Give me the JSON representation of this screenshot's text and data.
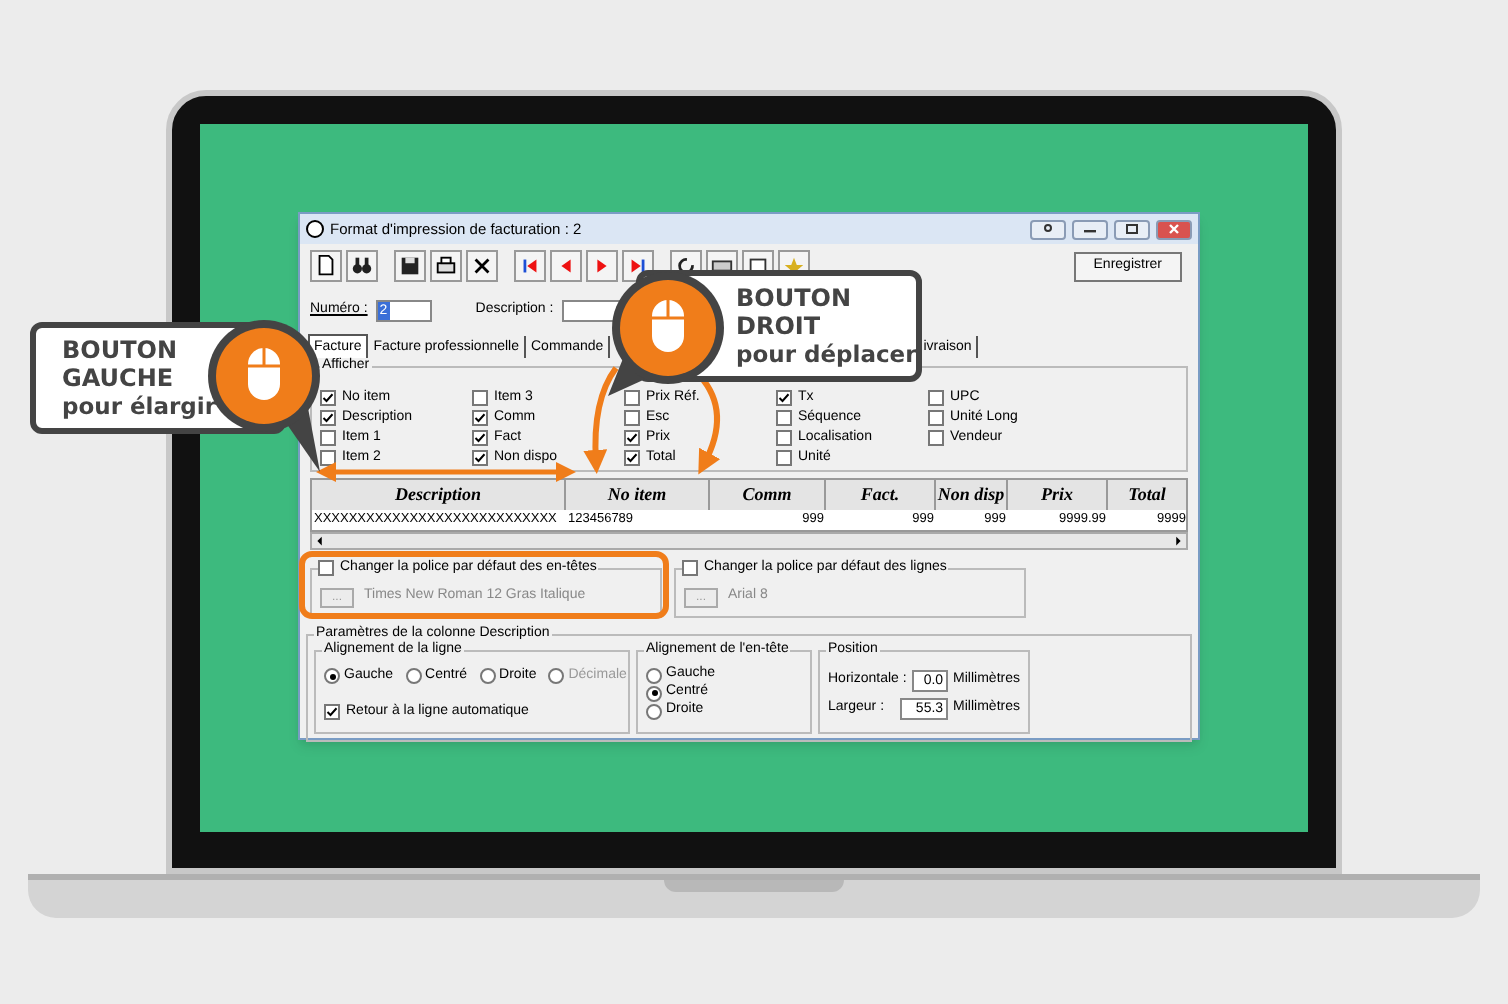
{
  "callouts": [
    {
      "lines": [
        "BOUTON",
        "GAUCHE"
      ],
      "subtitle": "pour élargir"
    },
    {
      "lines": [
        "BOUTON",
        "DROIT"
      ],
      "subtitle": "pour déplacer"
    }
  ],
  "window": {
    "title": "Format d'impression de facturation : 2"
  },
  "toolbar": {
    "save_button": "Enregistrer"
  },
  "header_fields": {
    "numero_label": "Numéro :",
    "numero_value": "2",
    "description_label": "Description :"
  },
  "tabs": [
    {
      "label": "Facture",
      "selected": true
    },
    {
      "label": "Facture professionnelle",
      "selected": false
    },
    {
      "label": "Commande",
      "selected": false
    },
    {
      "label": "ivraison",
      "selected": false
    }
  ],
  "afficher": {
    "title": "Afficher",
    "columns": [
      [
        {
          "label": "No item",
          "checked": true
        },
        {
          "label": "Description",
          "checked": true
        },
        {
          "label": "Item 1",
          "checked": false
        },
        {
          "label": "Item 2",
          "checked": false
        }
      ],
      [
        {
          "label": "Item 3",
          "checked": false
        },
        {
          "label": "Comm",
          "checked": true
        },
        {
          "label": "Fact",
          "checked": true
        },
        {
          "label": "Non dispo",
          "checked": true
        }
      ],
      [
        {
          "label": "Prix Réf.",
          "checked": false
        },
        {
          "label": "Esc",
          "checked": false
        },
        {
          "label": "Prix",
          "checked": true
        },
        {
          "label": "Total",
          "checked": true
        }
      ],
      [
        {
          "label": "Tx",
          "checked": true
        },
        {
          "label": "Séquence",
          "checked": false
        },
        {
          "label": "Localisation",
          "checked": false
        },
        {
          "label": "Unité",
          "checked": false
        }
      ],
      [
        {
          "label": "UPC",
          "checked": false
        },
        {
          "label": "Unité Long",
          "checked": false
        },
        {
          "label": "Vendeur",
          "checked": false
        }
      ]
    ]
  },
  "table": {
    "columns": [
      "Description",
      "No item",
      "Comm",
      "Fact.",
      "Non disp",
      "Prix",
      "Total"
    ],
    "row": [
      "XXXXXXXXXXXXXXXXXXXXXXXXXXXX",
      "123456789",
      "999",
      "999",
      "999",
      "9999.99",
      "9999"
    ]
  },
  "font_groups": [
    {
      "label": "Changer la police par défaut des en-têtes",
      "checked": false,
      "button": "...",
      "font": "Times New Roman 12 Gras Italique"
    },
    {
      "label": "Changer la police par défaut des lignes",
      "checked": false,
      "button": "...",
      "font": "Arial 8"
    }
  ],
  "description_params": {
    "title": "Paramètres de la colonne Description",
    "line_alignment": {
      "title": "Alignement de la ligne",
      "options": [
        {
          "label": "Gauche",
          "selected": true,
          "disabled": false
        },
        {
          "label": "Centré",
          "selected": false,
          "disabled": false
        },
        {
          "label": "Droite",
          "selected": false,
          "disabled": false
        },
        {
          "label": "Décimale",
          "selected": false,
          "disabled": true
        }
      ]
    },
    "wrap": {
      "label": "Retour à la ligne automatique",
      "checked": true
    },
    "header_alignment": {
      "title": "Alignement de l'en-tête",
      "options": [
        {
          "label": "Gauche",
          "selected": false,
          "disabled": false
        },
        {
          "label": "Centré",
          "selected": true,
          "disabled": false
        },
        {
          "label": "Droite",
          "selected": false,
          "disabled": false
        }
      ]
    },
    "position": {
      "title": "Position",
      "rows": [
        {
          "label": "Horizontale :",
          "value": "0.0",
          "unit": "Millimètres"
        },
        {
          "label": "Largeur :",
          "value": "55.3",
          "unit": "Millimètres"
        }
      ]
    }
  }
}
